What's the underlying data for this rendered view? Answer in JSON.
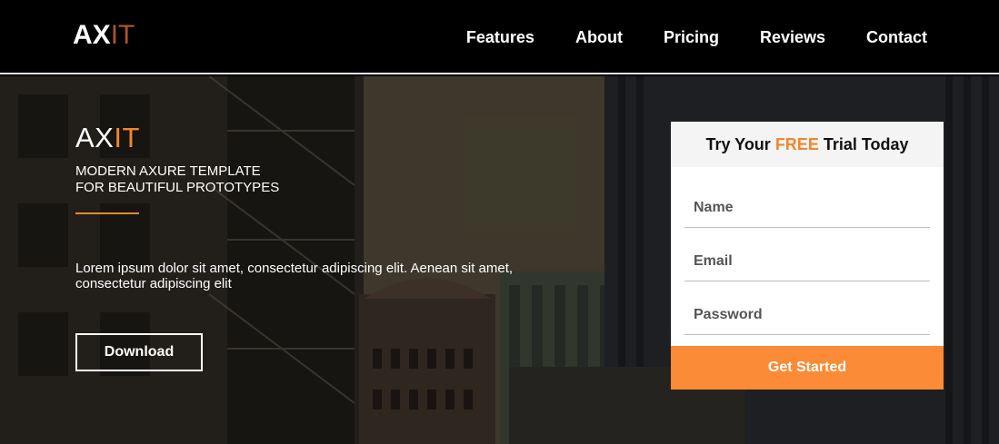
{
  "header": {
    "logo_ax": "AX",
    "logo_it": "IT",
    "nav": [
      "Features",
      "About",
      "Pricing",
      "Reviews",
      "Contact"
    ]
  },
  "hero": {
    "title_ax": "AX",
    "title_it": "IT",
    "subtitle_line1": "MODERN AXURE TEMPLATE",
    "subtitle_line2": "FOR BEAUTIFUL PROTOTYPES",
    "description": "Lorem ipsum dolor sit amet, consectetur adipiscing elit. Aenean sit amet, consectetur adipiscing elit",
    "download_label": "Download"
  },
  "form": {
    "heading_prefix": "Try Your ",
    "heading_free": "FREE",
    "heading_suffix": " Trial Today",
    "name_placeholder": "Name",
    "email_placeholder": "Email",
    "password_placeholder": "Password",
    "submit_label": "Get Started"
  },
  "colors": {
    "accent": "#f0872e",
    "button": "#fb8b36",
    "logo_it": "#a9552a"
  }
}
